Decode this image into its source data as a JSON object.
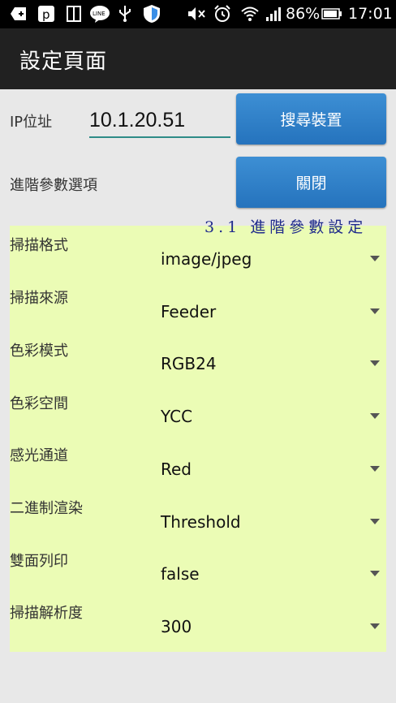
{
  "status_bar": {
    "battery": "86%",
    "time": "17:01",
    "icons": [
      "add-icon",
      "p-app-icon",
      "tablet-icon",
      "line-icon",
      "usb-icon",
      "shield-icon",
      "mute-icon",
      "alarm-icon",
      "wifi-icon",
      "signal-icon",
      "battery-icon"
    ]
  },
  "app_bar": {
    "title": "設定頁面"
  },
  "ip": {
    "label": "IP位址",
    "value": "10.1.20.51"
  },
  "search_button": {
    "label": "搜尋裝置"
  },
  "advanced": {
    "label": "進階參數選項",
    "toggle_label": "關閉"
  },
  "annotation": "3.1 進階參數設定",
  "settings": [
    {
      "label": "掃描格式",
      "value": "image/jpeg"
    },
    {
      "label": "掃描來源",
      "value": "Feeder"
    },
    {
      "label": "色彩模式",
      "value": "RGB24"
    },
    {
      "label": "色彩空間",
      "value": "YCC"
    },
    {
      "label": "感光通道",
      "value": "Red"
    },
    {
      "label": "二進制渲染",
      "value": "Threshold"
    },
    {
      "label": "雙面列印",
      "value": "false"
    },
    {
      "label": "掃描解析度",
      "value": "300"
    }
  ]
}
